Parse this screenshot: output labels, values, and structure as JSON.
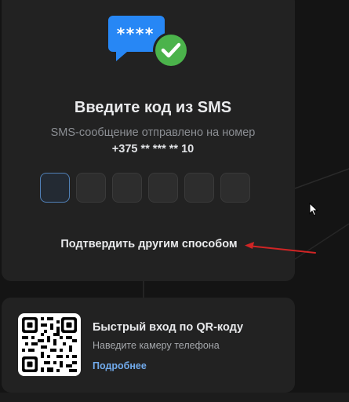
{
  "verification": {
    "title": "Введите код из SMS",
    "subtitle": "SMS-сообщение отправлено на номер",
    "phone": "+375 ** *** ** 10",
    "sms_icon_text": "****",
    "code_cells": [
      "",
      "",
      "",
      "",
      "",
      ""
    ],
    "alt_method_label": "Подтвердить другим способом"
  },
  "qr": {
    "title": "Быстрый вход по QR-коду",
    "subtitle": "Наведите камеру телефона",
    "more_link": "Подробнее"
  },
  "colors": {
    "background": "#141414",
    "card": "#222222",
    "accent_blue": "#2787f5",
    "success_green": "#4bb34b",
    "link": "#71aaeb",
    "annotation_red": "#d02525"
  },
  "icons": [
    "back-arrow-icon",
    "sms-code-icon",
    "checkmark-icon",
    "qr-code-icon",
    "mouse-cursor-icon"
  ]
}
